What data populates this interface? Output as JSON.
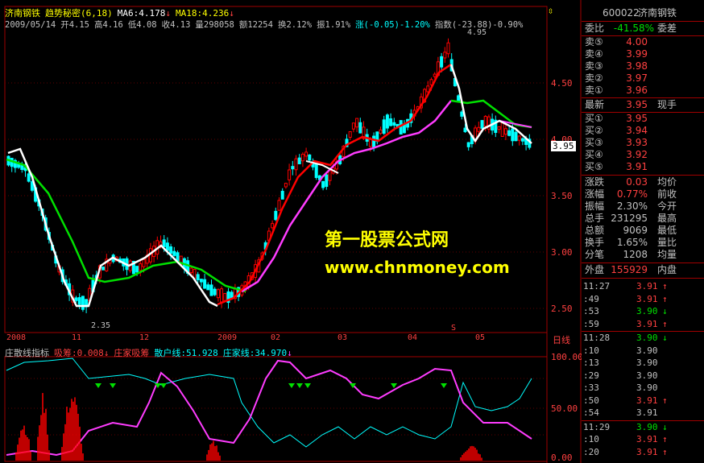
{
  "header": {
    "stock_name": "济南钢铁",
    "formula": "趋势秘密(6,18)",
    "ma6": "MA6:4.178",
    "ma18": "MA18:4.236",
    "down_arrow": "↓",
    "date": "2009/05/14",
    "open": "开4.15",
    "high": "高4.16",
    "low": "低4.08",
    "close": "收4.13",
    "volume": "量298058",
    "amount": "额12254",
    "turnover": "换2.12%",
    "amplitude": "振1.91%",
    "change": "涨(-0.05)-1.20%",
    "index": "指数(-23.88)-0.90%"
  },
  "indicator_header": {
    "name": "庄散线指标",
    "absorb": "吸筹:0.008",
    "dealer_absorb": "庄家吸筹",
    "retail_line": "散户线:51.928",
    "dealer_line": "庄家线:34.970"
  },
  "price_axis": {
    "labels": [
      "4.50",
      "4.00",
      "3.50",
      "3.00",
      "2.50"
    ],
    "current_price": "3.95"
  },
  "indicator_axis": {
    "labels": [
      "100.00",
      "50.00",
      "0.00"
    ]
  },
  "time_axis": {
    "labels": [
      "2008",
      "11",
      "12",
      "2009",
      "02",
      "03",
      "04",
      "05"
    ],
    "right_label": "日线",
    "marker": "S"
  },
  "annotations": {
    "high_label": "4.95",
    "low_label": "2.35"
  },
  "watermark": {
    "line1": "第一股票公式网",
    "line2": "www.chnmoney.com"
  },
  "colors": {
    "up": "#ff0000",
    "down": "#00ffff",
    "ma_up": "#ff0000",
    "ma_down": "#00e000",
    "ma_fast": "#ffffff",
    "ma_slow": "#ff3cff",
    "retail": "#00ffff",
    "dealer": "#ff3cff",
    "absorb": "#ff0000",
    "signal": "#00e000"
  },
  "quote": {
    "code": "600022",
    "name": "济南钢铁",
    "wb_label": "委比",
    "wb_value": "-41.58%",
    "wc_label": "委差",
    "sells": [
      {
        "label": "卖⑤",
        "price": "4.00"
      },
      {
        "label": "卖④",
        "price": "3.99"
      },
      {
        "label": "卖③",
        "price": "3.98"
      },
      {
        "label": "卖②",
        "price": "3.97"
      },
      {
        "label": "卖①",
        "price": "3.96"
      }
    ],
    "latest_label": "最新",
    "latest_value": "3.95",
    "now_hand": "现手",
    "buys": [
      {
        "label": "买①",
        "price": "3.95"
      },
      {
        "label": "买②",
        "price": "3.94"
      },
      {
        "label": "买③",
        "price": "3.93"
      },
      {
        "label": "买④",
        "price": "3.92"
      },
      {
        "label": "买⑤",
        "price": "3.91"
      }
    ],
    "stats": [
      {
        "label": "涨跌",
        "value": "0.03",
        "right": "均价"
      },
      {
        "label": "涨幅",
        "value": "0.77%",
        "right": "前收"
      },
      {
        "label": "振幅",
        "value": "2.30%",
        "right": "今开"
      },
      {
        "label": "总手",
        "value": "231295",
        "right": "最高"
      },
      {
        "label": "总额",
        "value": "9069",
        "right": "最低"
      },
      {
        "label": "换手",
        "value": "1.65%",
        "right": "量比"
      },
      {
        "label": "分笔",
        "value": "1208",
        "right": "均量"
      }
    ],
    "outer_label": "外盘",
    "outer_value": "155929",
    "inner_label": "内盘"
  },
  "ticks": [
    {
      "time": "11:27",
      "price": "3.91",
      "dir": "↑"
    },
    {
      "time": ":49",
      "price": "3.91",
      "dir": "↑"
    },
    {
      "time": ":53",
      "price": "3.90",
      "dir": "↓"
    },
    {
      "time": ":59",
      "price": "3.91",
      "dir": "↑"
    },
    {
      "time": "11:28",
      "price": "3.90",
      "dir": "↓"
    },
    {
      "time": ":10",
      "price": "3.90",
      "dir": ""
    },
    {
      "time": ":13",
      "price": "3.90",
      "dir": ""
    },
    {
      "time": ":29",
      "price": "3.90",
      "dir": ""
    },
    {
      "time": ":33",
      "price": "3.90",
      "dir": ""
    },
    {
      "time": ":50",
      "price": "3.91",
      "dir": "↑"
    },
    {
      "time": ":54",
      "price": "3.91",
      "dir": ""
    },
    {
      "time": "11:29",
      "price": "3.90",
      "dir": "↓"
    },
    {
      "time": ":10",
      "price": "3.91",
      "dir": "↑"
    },
    {
      "time": ":20",
      "price": "3.91",
      "dir": "↑"
    }
  ]
}
